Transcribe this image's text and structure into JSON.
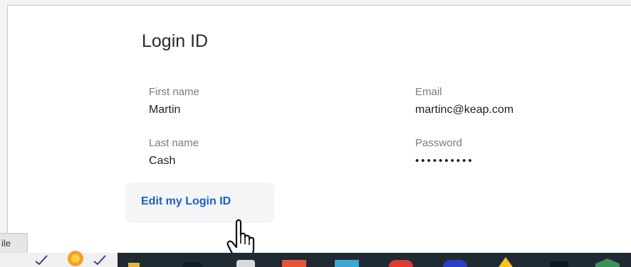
{
  "section": {
    "title": "Login ID"
  },
  "fields": {
    "first_name": {
      "label": "First name",
      "value": "Martin"
    },
    "last_name": {
      "label": "Last name",
      "value": "Cash"
    },
    "email": {
      "label": "Email",
      "value": "martinc@keap.com"
    },
    "password": {
      "label": "Password",
      "value": "••••••••••"
    }
  },
  "actions": {
    "edit_label": "Edit my Login ID"
  },
  "tab": {
    "label": "ile"
  },
  "colors": {
    "link": "#1f5ec7",
    "taskbar": "#202a33",
    "button_bg": "#f4f5f7"
  },
  "taskbar_icons": [
    "checkmark-icon",
    "folder-icon",
    "app-icon",
    "app-icon",
    "app-icon",
    "app-icon",
    "app-icon",
    "app-icon",
    "app-icon",
    "app-icon"
  ]
}
